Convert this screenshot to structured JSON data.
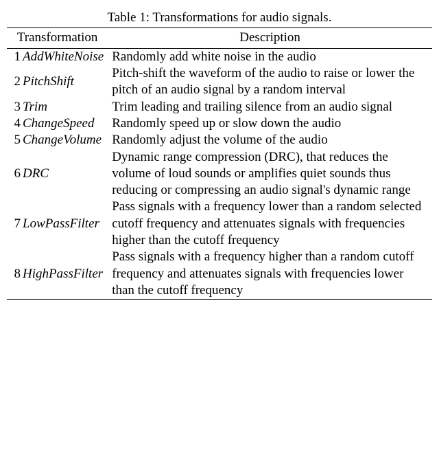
{
  "caption": "Table 1: Transformations for audio signals.",
  "headers": {
    "col1": "Transformation",
    "col2": "Description"
  },
  "rows": [
    {
      "n": "1",
      "name": "AddWhiteNoise",
      "desc": "Randomly add white noise in the audio"
    },
    {
      "n": "2",
      "name": "PitchShift",
      "desc": "Pitch-shift the waveform of the audio to raise or lower the pitch of an audio signal by a random interval"
    },
    {
      "n": "3",
      "name": "Trim",
      "desc": "Trim leading and trailing silence from an audio signal"
    },
    {
      "n": "4",
      "name": "ChangeSpeed",
      "desc": "Randomly speed up or slow down the audio"
    },
    {
      "n": "5",
      "name": "ChangeVolume",
      "desc": "Randomly adjust the volume of the audio"
    },
    {
      "n": "6",
      "name": "DRC",
      "desc": "Dynamic range compression (DRC), that reduces the volume of loud sounds or amplifies quiet sounds thus reducing or compressing an audio signal's dynamic range"
    },
    {
      "n": "7",
      "name": "LowPassFilter",
      "desc": "Pass signals with a frequency lower than a random selected cutoff frequency and attenuates signals with frequencies higher than the cutoff frequency"
    },
    {
      "n": "8",
      "name": "HighPassFilter",
      "desc": "Pass signals with a frequency higher than a random cutoff frequency and attenuates signals with frequencies lower than the cutoff frequency"
    }
  ]
}
